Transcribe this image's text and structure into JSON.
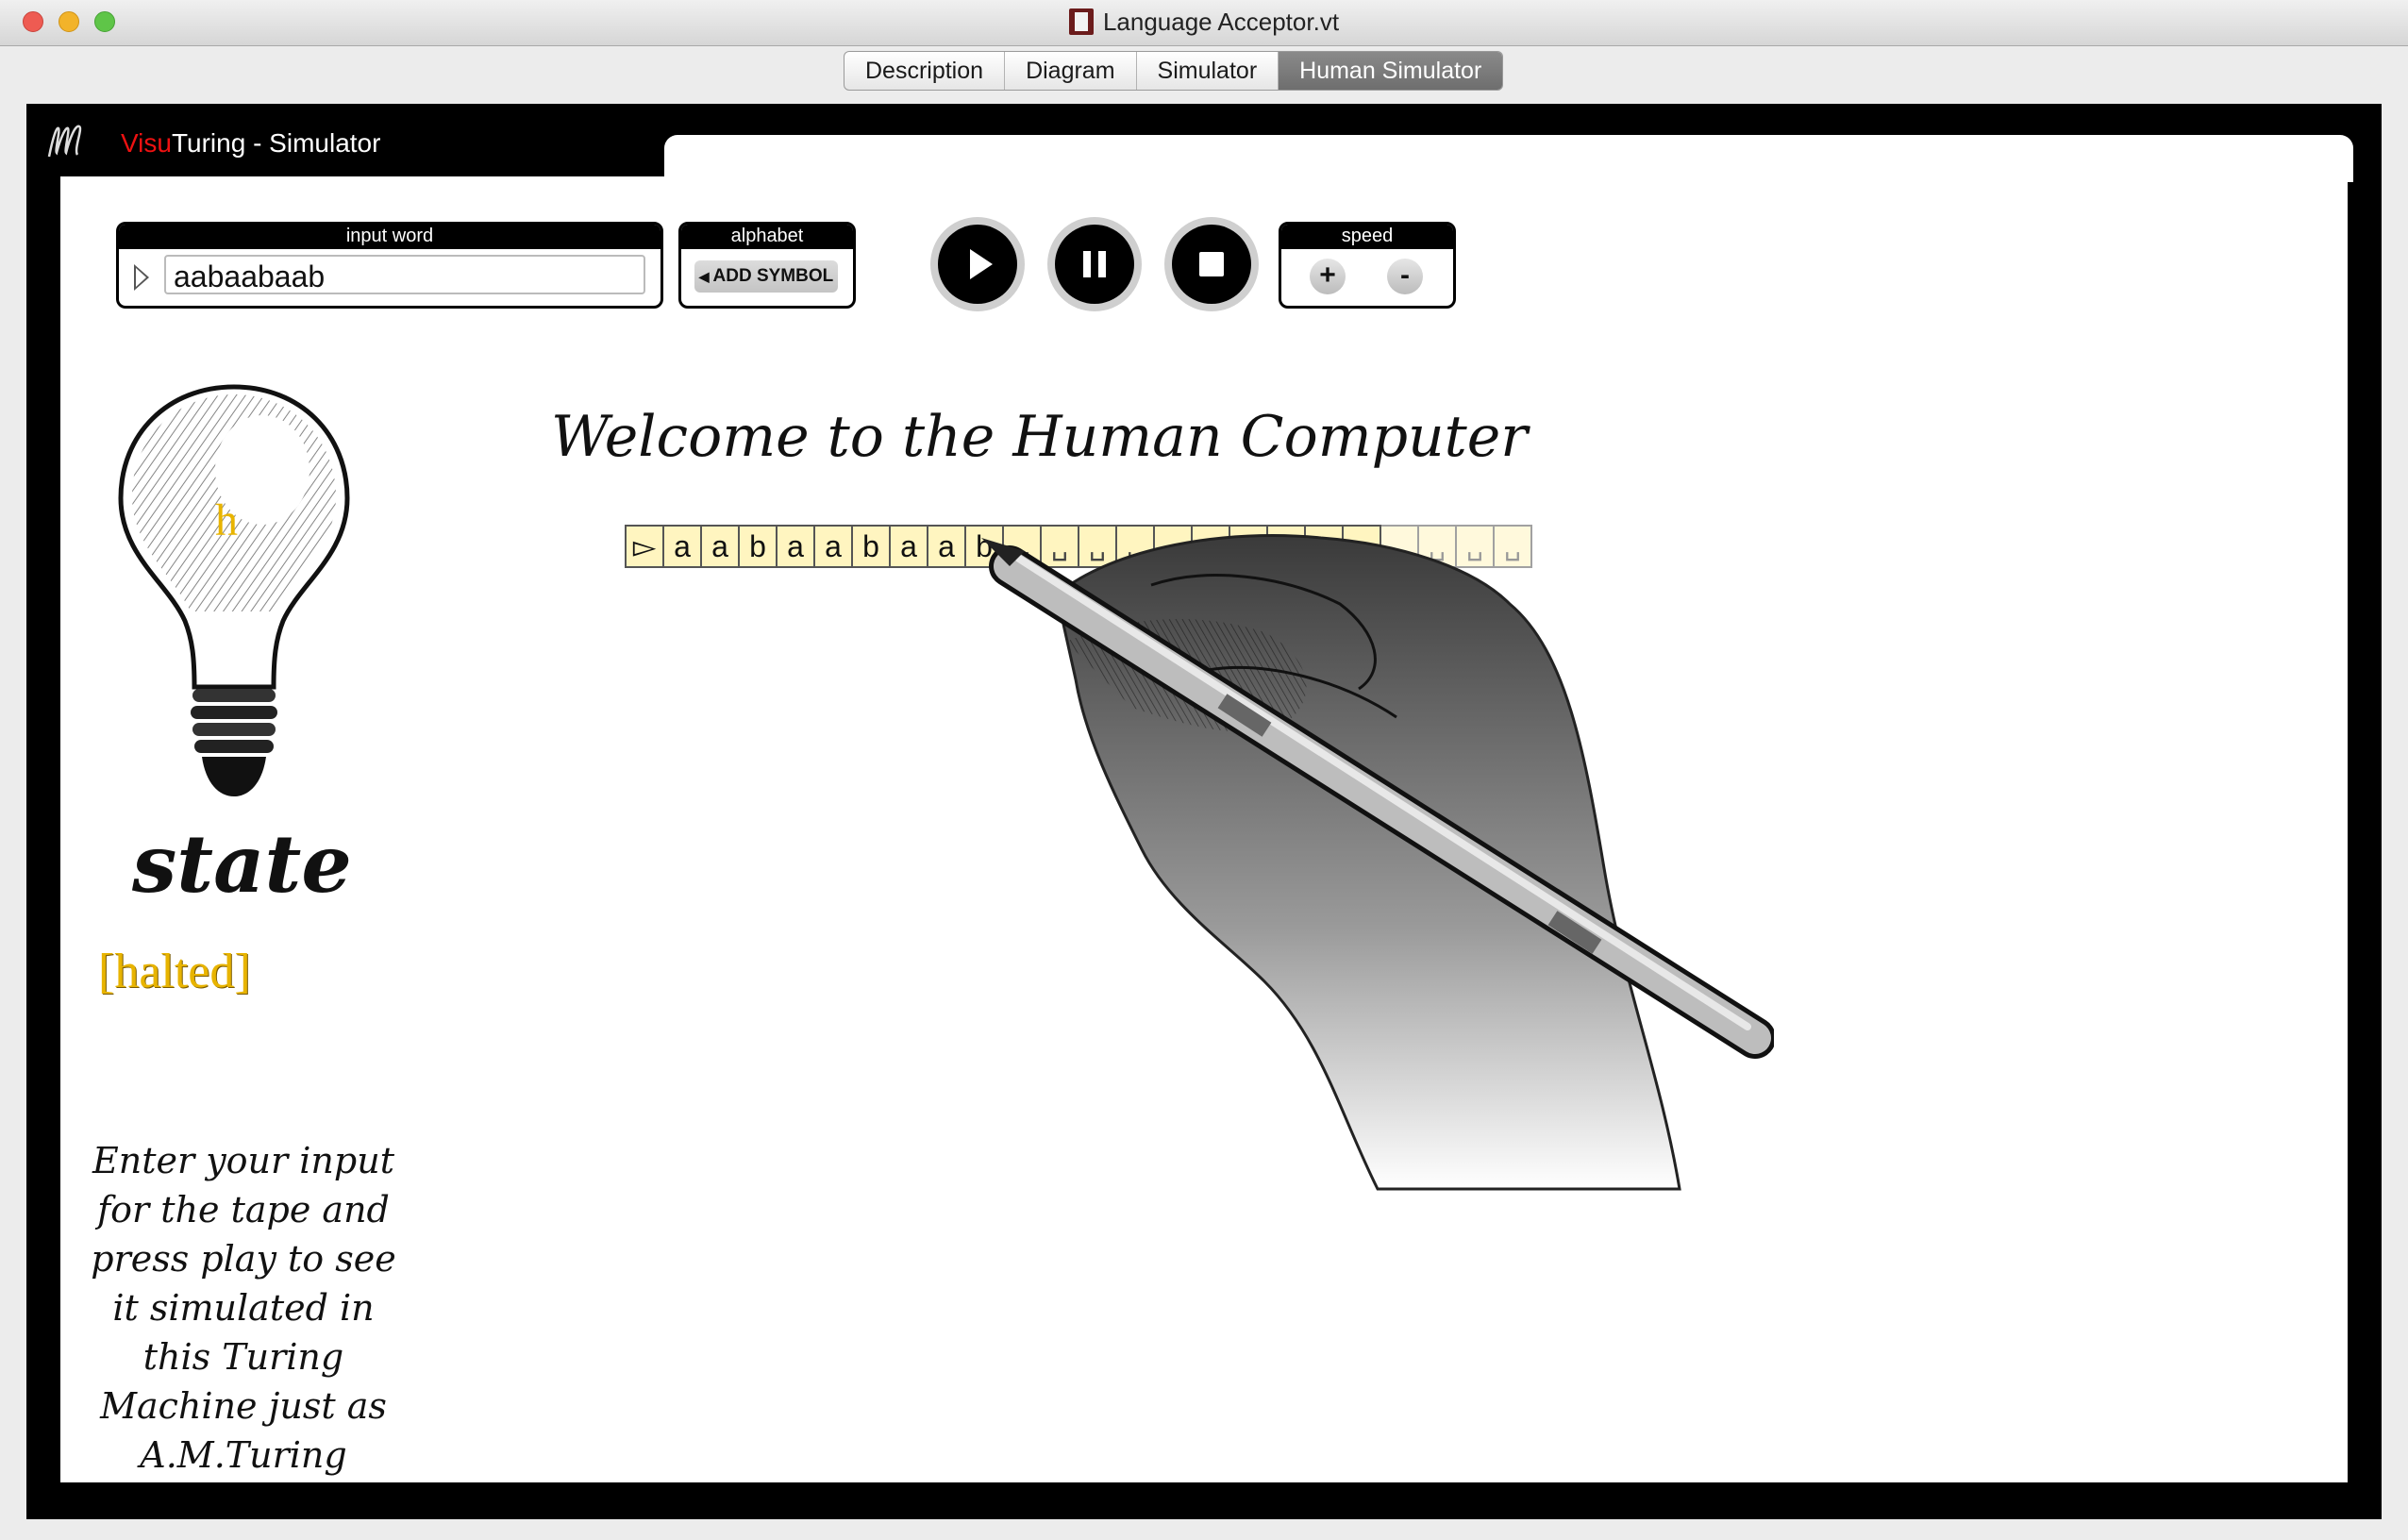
{
  "window": {
    "title": "Language Acceptor.vt",
    "traffic_lights": [
      "#ee5b52",
      "#f2b32a",
      "#5fc548"
    ]
  },
  "tabs": [
    {
      "label": "Description",
      "active": false
    },
    {
      "label": "Diagram",
      "active": false
    },
    {
      "label": "Simulator",
      "active": false
    },
    {
      "label": "Human Simulator",
      "active": true
    }
  ],
  "brand": {
    "prefix": "Visu",
    "suffix": "Turing - Simulator",
    "prefix_color": "#e11111"
  },
  "controls": {
    "input_word_label": "input word",
    "input_word_value": "aabaabaab",
    "alphabet_label": "alphabet",
    "add_symbol_label": "ADD SYMBOL",
    "speed_label": "speed",
    "speed_plus": "+",
    "speed_minus": "-",
    "buttons": [
      "play-icon",
      "pause-icon",
      "stop-icon"
    ]
  },
  "main": {
    "welcome": "Welcome to the Human Computer",
    "state_label": "state",
    "current_state": "h",
    "status": "[halted]",
    "help_text": "Enter your input for the tape and press play to see it simulated in this Turing Machine just as A.M.Turing"
  },
  "tape": [
    "▻",
    "a",
    "a",
    "b",
    "a",
    "a",
    "b",
    "a",
    "a",
    "b",
    "␣",
    "␣",
    "␣",
    "␣",
    "␣",
    "␣",
    "␣",
    "␣",
    "␣",
    "␣",
    "␣",
    "␣",
    "␣",
    "␣"
  ],
  "colors": {
    "tape_cell": "#fff5c0",
    "halted": "#e8b400",
    "frame": "#000000"
  }
}
